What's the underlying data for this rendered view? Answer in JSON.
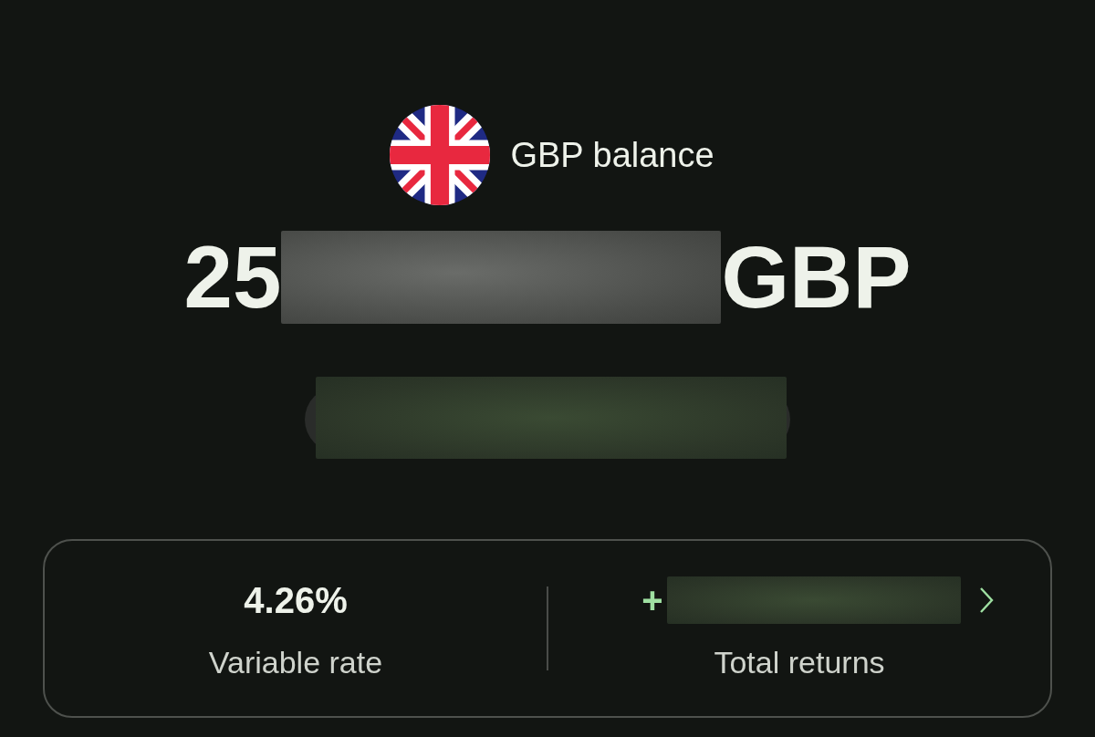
{
  "header": {
    "title": "GBP balance"
  },
  "balance": {
    "visible_start": "25",
    "currency": "GBP"
  },
  "stats": [
    {
      "kind": "value",
      "value": "4.26%",
      "label": "Variable rate"
    },
    {
      "kind": "link",
      "value": "+",
      "label": "Total returns"
    }
  ]
}
